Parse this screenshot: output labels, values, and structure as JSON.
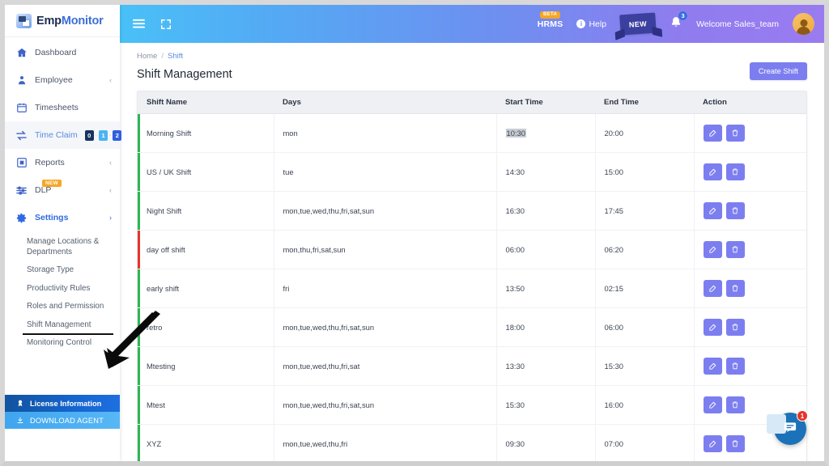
{
  "brand": {
    "part1": "Emp",
    "part2": "Monitor",
    "logo_icon": "app-logo-icon"
  },
  "sidebar": {
    "items": [
      {
        "label": "Dashboard",
        "icon": "home-icon",
        "chevron": "",
        "active": false
      },
      {
        "label": "Employee",
        "icon": "user-group-icon",
        "chevron": "‹",
        "active": false
      },
      {
        "label": "Timesheets",
        "icon": "calendar-icon",
        "chevron": "",
        "active": false
      },
      {
        "label": "Time Claim",
        "icon": "exchange-icon",
        "chevron": "",
        "active": true
      },
      {
        "label": "Reports",
        "icon": "report-icon",
        "chevron": "‹",
        "active": false
      },
      {
        "label": "DLP",
        "icon": "sliders-icon",
        "chevron": "‹",
        "active": false,
        "tag": "NEW"
      },
      {
        "label": "Settings",
        "icon": "gear-icon",
        "chevron": "›",
        "active": false
      }
    ],
    "time_claim_badges": [
      {
        "value": "0",
        "color": "#17335f"
      },
      {
        "value": "1",
        "color": "#4ab4f0"
      },
      {
        "value": "2",
        "color": "#2f5fe0"
      }
    ],
    "dlp_tag": "NEW",
    "submenu": [
      {
        "label": "Manage Locations & Departments"
      },
      {
        "label": "Storage Type"
      },
      {
        "label": "Productivity Rules"
      },
      {
        "label": "Roles and Permission"
      },
      {
        "label": "Shift Management",
        "underlined": true
      },
      {
        "label": "Monitoring Control"
      }
    ],
    "license_label": "License Information",
    "license_icon": "medal-icon",
    "download_label": "DOWNLOAD AGENT",
    "download_icon": "download-icon"
  },
  "header": {
    "menu_icon": "hamburger-menu-icon",
    "expand_icon": "fullscreen-icon",
    "hrms_label": "HRMS",
    "hrms_badge": "BETA",
    "help_label": "Help",
    "help_icon": "info-icon",
    "new_ribbon_label": "NEW",
    "bell_icon": "bell-icon",
    "bell_count": "3",
    "welcome_text": "Welcome  Sales_team",
    "avatar_icon": "user-avatar"
  },
  "breadcrumb": {
    "home": "Home",
    "sep": "/",
    "current": "Shift"
  },
  "page": {
    "title": "Shift Management",
    "create_button": "Create Shift"
  },
  "table": {
    "headers": [
      "Shift Name",
      "Days",
      "Start Time",
      "End Time",
      "Action"
    ],
    "edit_icon": "edit-icon",
    "delete_icon": "trash-icon",
    "rows": [
      {
        "name": "Morning Shift",
        "days": "mon",
        "start": "10:30",
        "end": "20:00",
        "bar": "#2fb553",
        "start_highlighted": true
      },
      {
        "name": "US / UK Shift",
        "days": "tue",
        "start": "14:30",
        "end": "15:00",
        "bar": "#2fb553",
        "start_highlighted": false
      },
      {
        "name": "Night Shift",
        "days": "mon,tue,wed,thu,fri,sat,sun",
        "start": "16:30",
        "end": "17:45",
        "bar": "#2fb553",
        "start_highlighted": false
      },
      {
        "name": "day off shift",
        "days": "mon,thu,fri,sat,sun",
        "start": "06:00",
        "end": "06:20",
        "bar": "#e5352b",
        "start_highlighted": false
      },
      {
        "name": "early shift",
        "days": "fri",
        "start": "13:50",
        "end": "02:15",
        "bar": "#2fb553",
        "start_highlighted": false
      },
      {
        "name": "retro",
        "days": "mon,tue,wed,thu,fri,sat,sun",
        "start": "18:00",
        "end": "06:00",
        "bar": "#2fb553",
        "start_highlighted": false
      },
      {
        "name": "Mtesting",
        "days": "mon,tue,wed,thu,fri,sat",
        "start": "13:30",
        "end": "15:30",
        "bar": "#2fb553",
        "start_highlighted": false
      },
      {
        "name": "Mtest",
        "days": "mon,tue,wed,thu,fri,sat,sun",
        "start": "15:30",
        "end": "16:00",
        "bar": "#2fb553",
        "start_highlighted": false
      },
      {
        "name": "XYZ",
        "days": "mon,tue,wed,thu,fri",
        "start": "09:30",
        "end": "07:00",
        "bar": "#2fb553",
        "start_highlighted": false
      }
    ]
  },
  "chat": {
    "icon": "chat-bubble-icon",
    "badge": "1"
  },
  "annotation": {
    "arrow_icon": "pointer-arrow-annotation"
  },
  "colors": {
    "accent_purple": "#7c7ef0",
    "header_gradient_start": "#49c0f7",
    "header_gradient_end": "#9a7bf0",
    "row_bar_ok": "#2fb553",
    "row_bar_off": "#e5352b",
    "badge_orange": "#f5a623"
  }
}
